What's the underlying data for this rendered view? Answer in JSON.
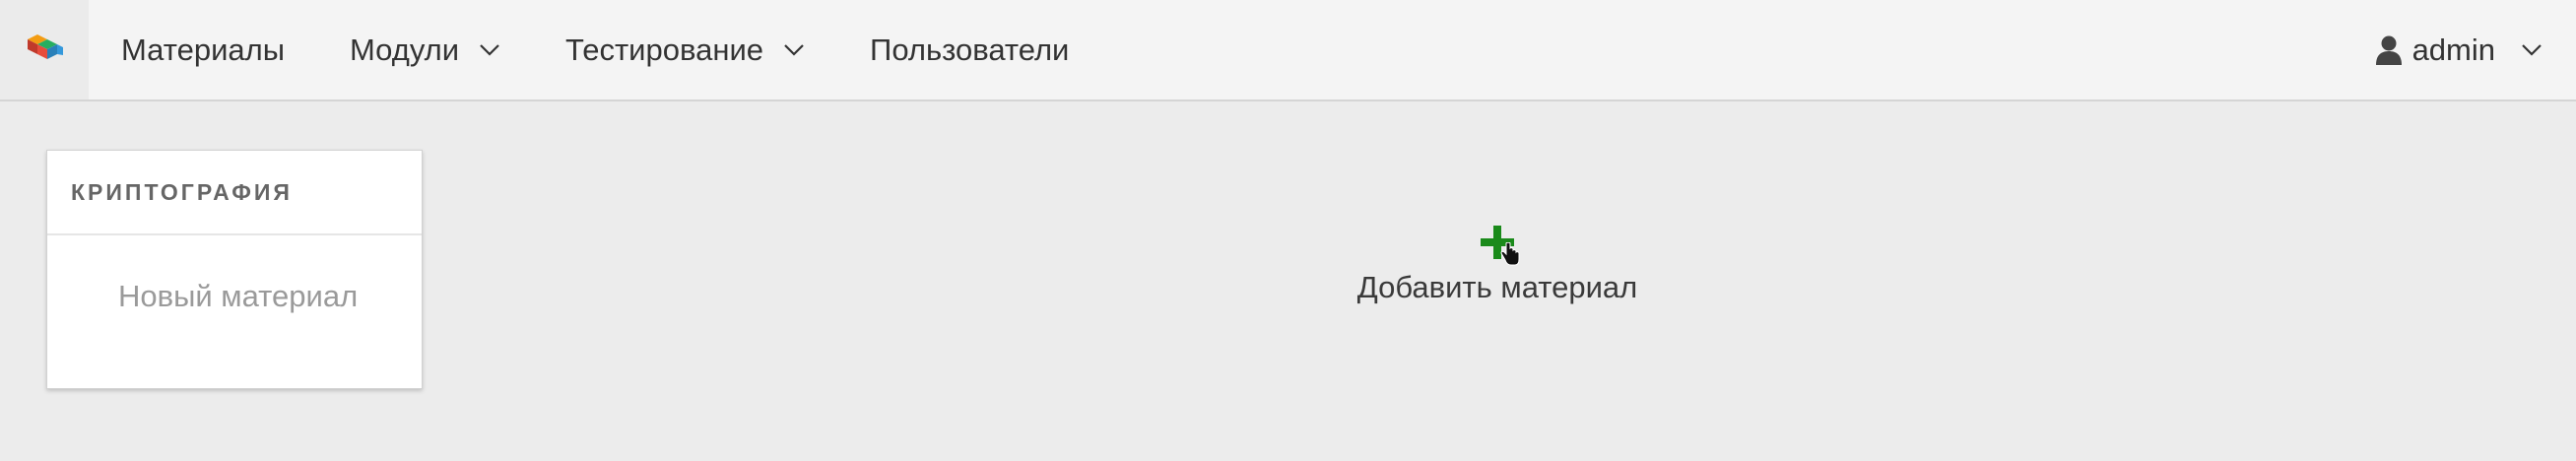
{
  "app": {
    "logo_icon": "colorful-blocks-logo-icon"
  },
  "nav": {
    "items": [
      {
        "label": "Материалы",
        "has_dropdown": false
      },
      {
        "label": "Модули",
        "has_dropdown": true
      },
      {
        "label": "Тестирование",
        "has_dropdown": true
      },
      {
        "label": "Пользователи",
        "has_dropdown": false
      }
    ],
    "user": {
      "icon": "user-icon",
      "name": "admin",
      "has_dropdown": true
    }
  },
  "sidebar": {
    "section_title": "КРИПТОГРАФИЯ",
    "items": [
      {
        "label": "Новый материал"
      }
    ]
  },
  "main": {
    "add_material": {
      "icon": "plus-icon",
      "label": "Добавить материал",
      "icon_color": "#1a8a1a"
    }
  },
  "colors": {
    "navbar_bg": "#f4f4f4",
    "page_bg": "#ececec",
    "accent_green": "#1a8a1a"
  }
}
